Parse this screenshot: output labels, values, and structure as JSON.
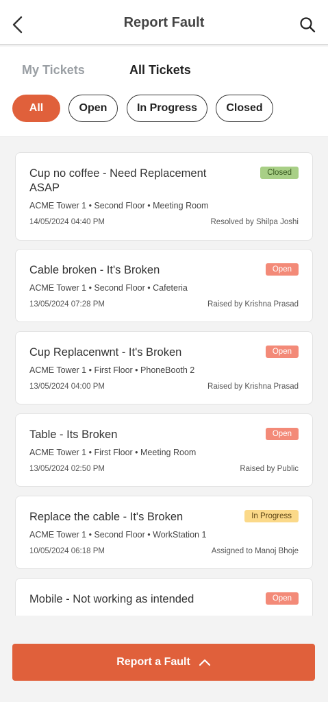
{
  "header": {
    "title": "Report Fault",
    "back_icon": "chevron-left-icon",
    "search_icon": "search-icon"
  },
  "tabs": [
    {
      "label": "My Tickets",
      "active": false
    },
    {
      "label": "All Tickets",
      "active": true
    }
  ],
  "filters": [
    {
      "label": "All",
      "active": true
    },
    {
      "label": "Open",
      "active": false
    },
    {
      "label": "In Progress",
      "active": false
    },
    {
      "label": "Closed",
      "active": false
    }
  ],
  "tickets": [
    {
      "title": "Cup no coffee - Need Replacement ASAP",
      "location": "ACME Tower 1 • Second Floor • Meeting Room",
      "date": "14/05/2024 04:40 PM",
      "by": "Resolved by Shilpa Joshi",
      "status": "Closed"
    },
    {
      "title": "Cable broken  - It's Broken",
      "location": "ACME Tower 1 • Second Floor • Cafeteria",
      "date": "13/05/2024 07:28 PM",
      "by": "Raised by Krishna Prasad",
      "status": "Open"
    },
    {
      "title": "Cup Replacenwnt - It's Broken",
      "location": "ACME Tower 1 • First Floor • PhoneBooth 2",
      "date": "13/05/2024 04:00 PM",
      "by": "Raised by Krishna Prasad",
      "status": "Open"
    },
    {
      "title": "Table - Its Broken",
      "location": "ACME Tower 1 • First Floor • Meeting Room",
      "date": "13/05/2024 02:50 PM",
      "by": "Raised by Public",
      "status": "Open"
    },
    {
      "title": "Replace the cable - It's Broken",
      "location": "ACME Tower 1 • Second Floor • WorkStation 1",
      "date": "10/05/2024 06:18 PM",
      "by": "Assigned to Manoj Bhoje",
      "status": "In Progress"
    },
    {
      "title": "Mobile  - Not working as intended",
      "status": "Open"
    }
  ],
  "colors": {
    "accent": "#e0603b",
    "open_badge": "#f38a78",
    "closed_badge": "#a8cf86",
    "progress_badge": "#fbd989"
  },
  "report_button": {
    "label": "Report a Fault",
    "icon": "chevron-up-icon"
  }
}
